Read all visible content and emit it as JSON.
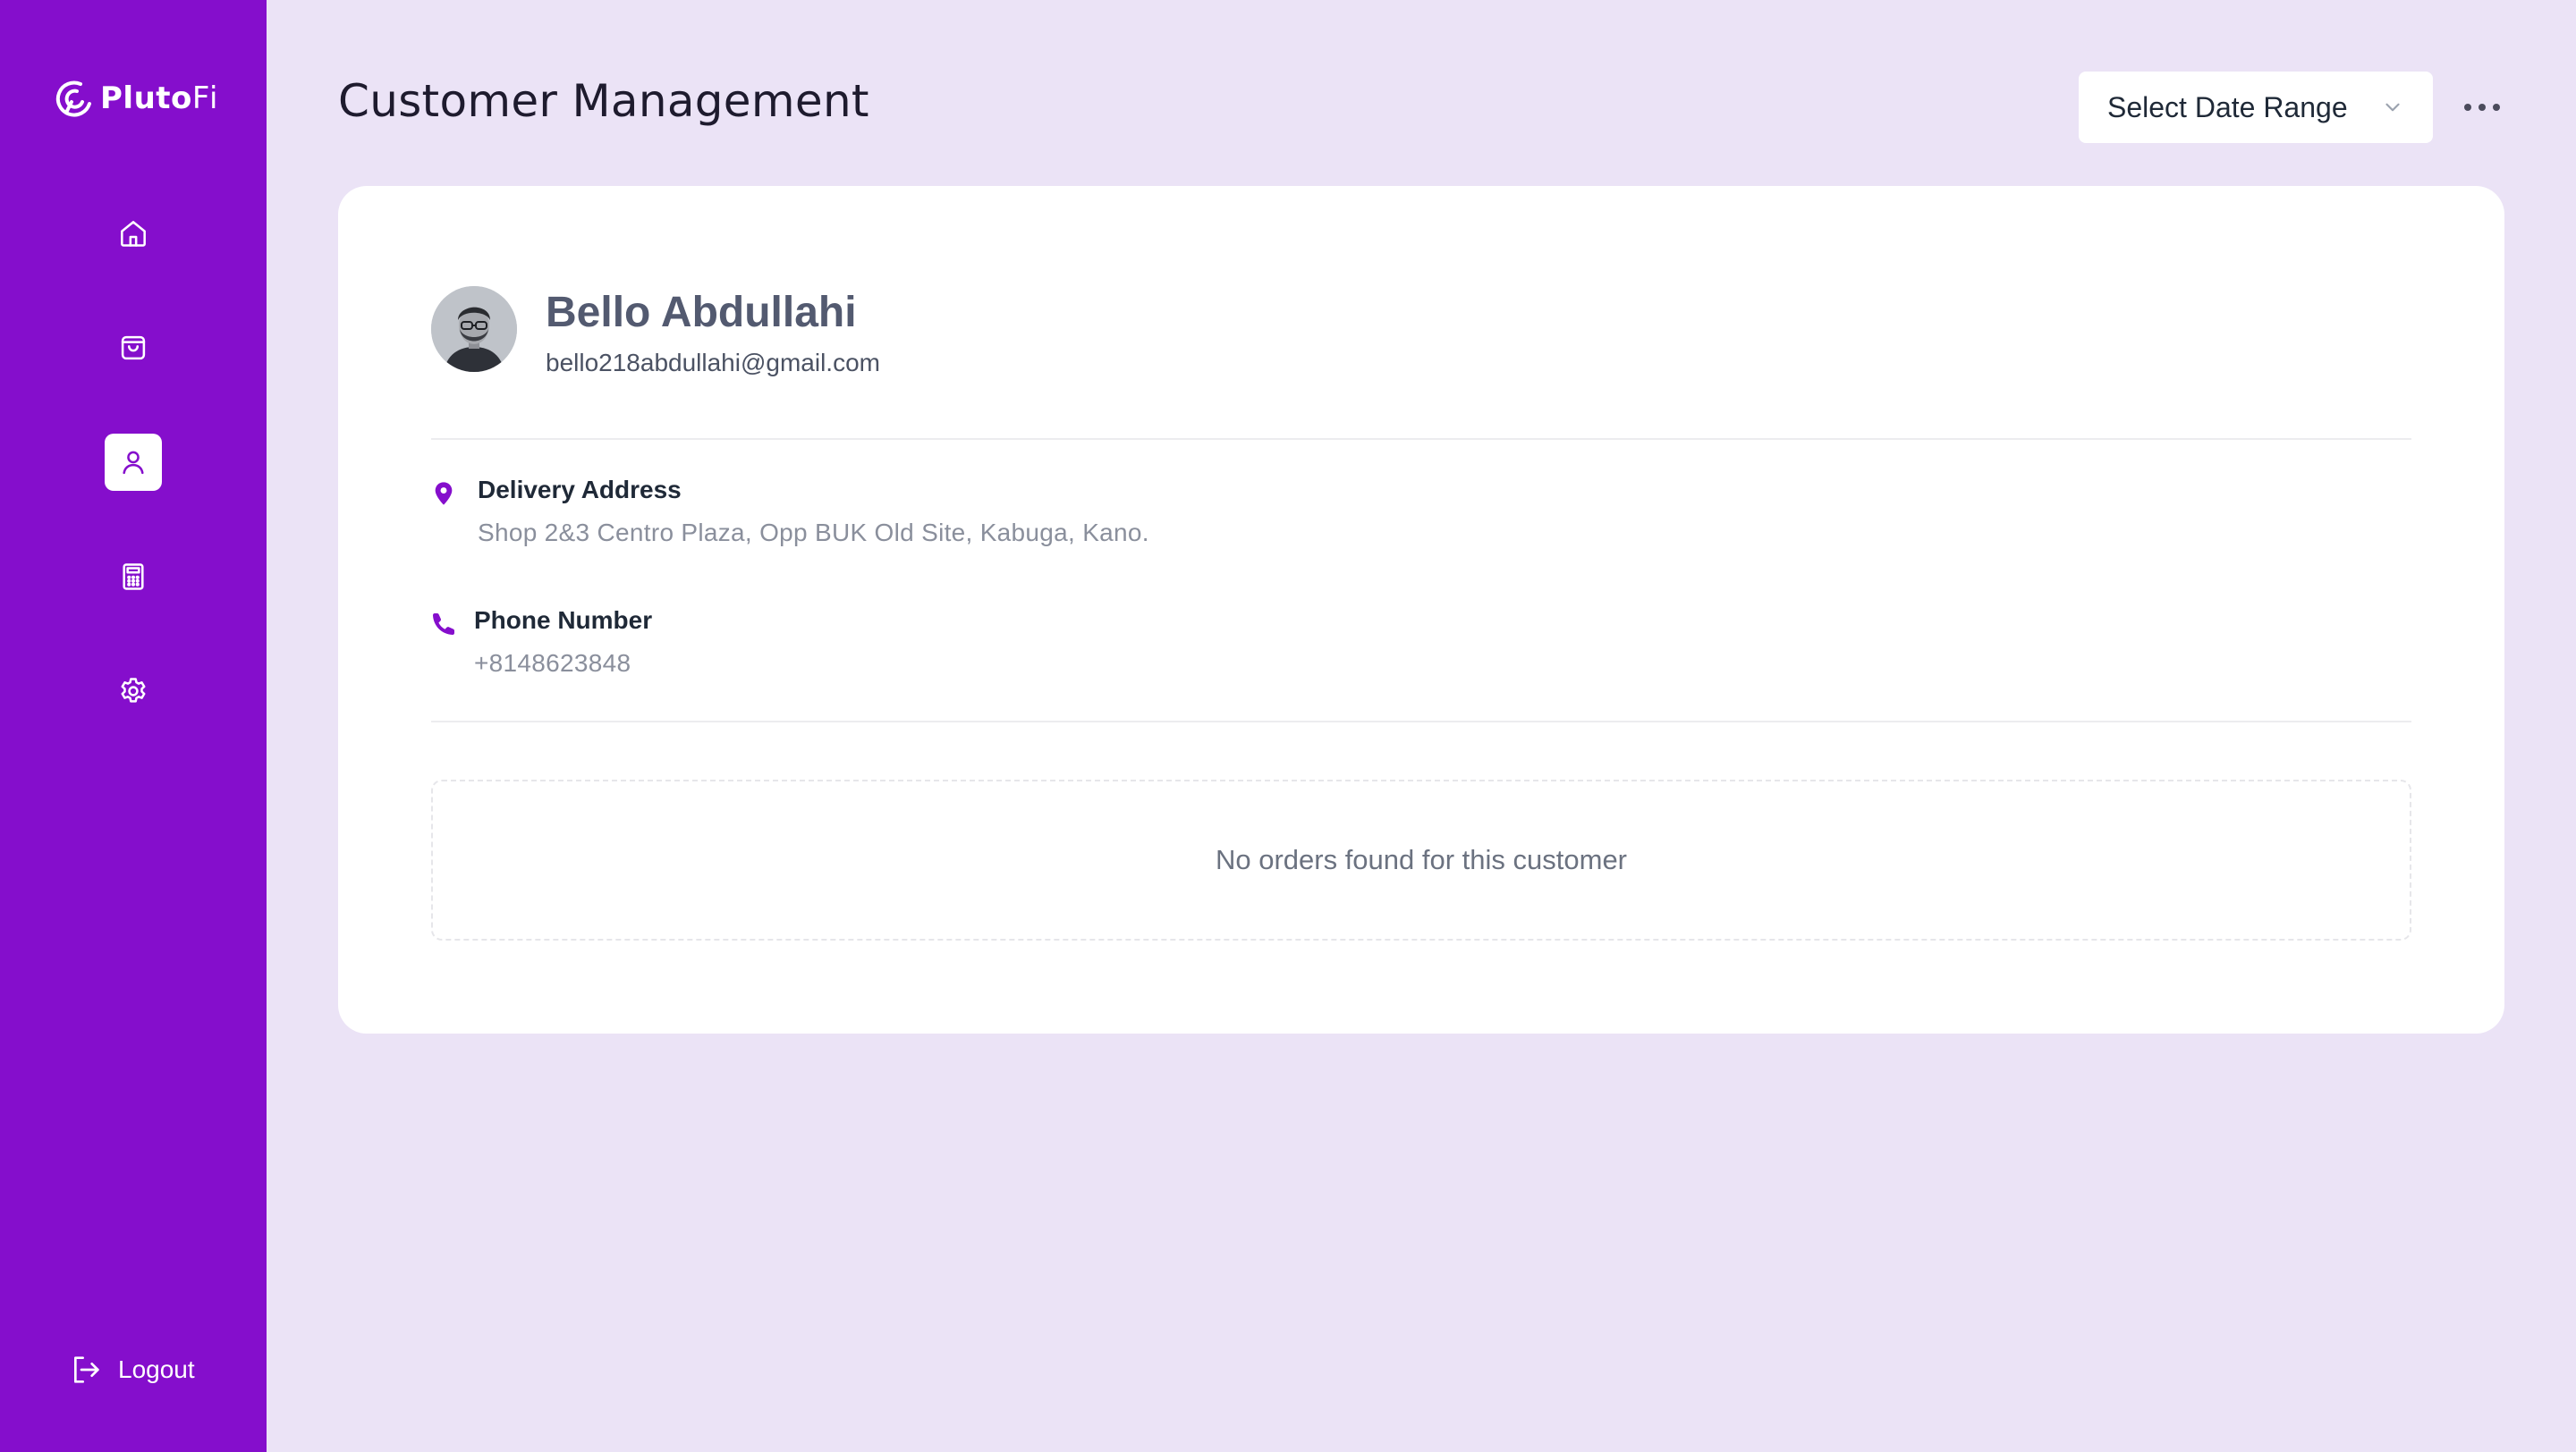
{
  "app": {
    "brand_bold": "Pluto",
    "brand_thin": "Fi",
    "accent_color": "#850ECC",
    "background_color": "#EBE3F6"
  },
  "sidebar": {
    "items": [
      {
        "name": "home",
        "icon": "home-icon",
        "active": false
      },
      {
        "name": "orders",
        "icon": "shopping-bag-icon",
        "active": false
      },
      {
        "name": "customers",
        "icon": "user-icon",
        "active": true
      },
      {
        "name": "calculator",
        "icon": "calculator-icon",
        "active": false
      },
      {
        "name": "settings",
        "icon": "gear-icon",
        "active": false
      }
    ],
    "logout_label": "Logout"
  },
  "header": {
    "title": "Customer Management",
    "date_range_label": "Select Date Range"
  },
  "customer": {
    "name": "Bello Abdullahi",
    "email": "bello218abdullahi@gmail.com",
    "delivery_address_label": "Delivery Address",
    "delivery_address": "Shop 2&3 Centro Plaza, Opp BUK Old Site, Kabuga, Kano.",
    "phone_label": "Phone Number",
    "phone": "+8148623848"
  },
  "orders": {
    "empty_message": "No orders found for this customer"
  }
}
